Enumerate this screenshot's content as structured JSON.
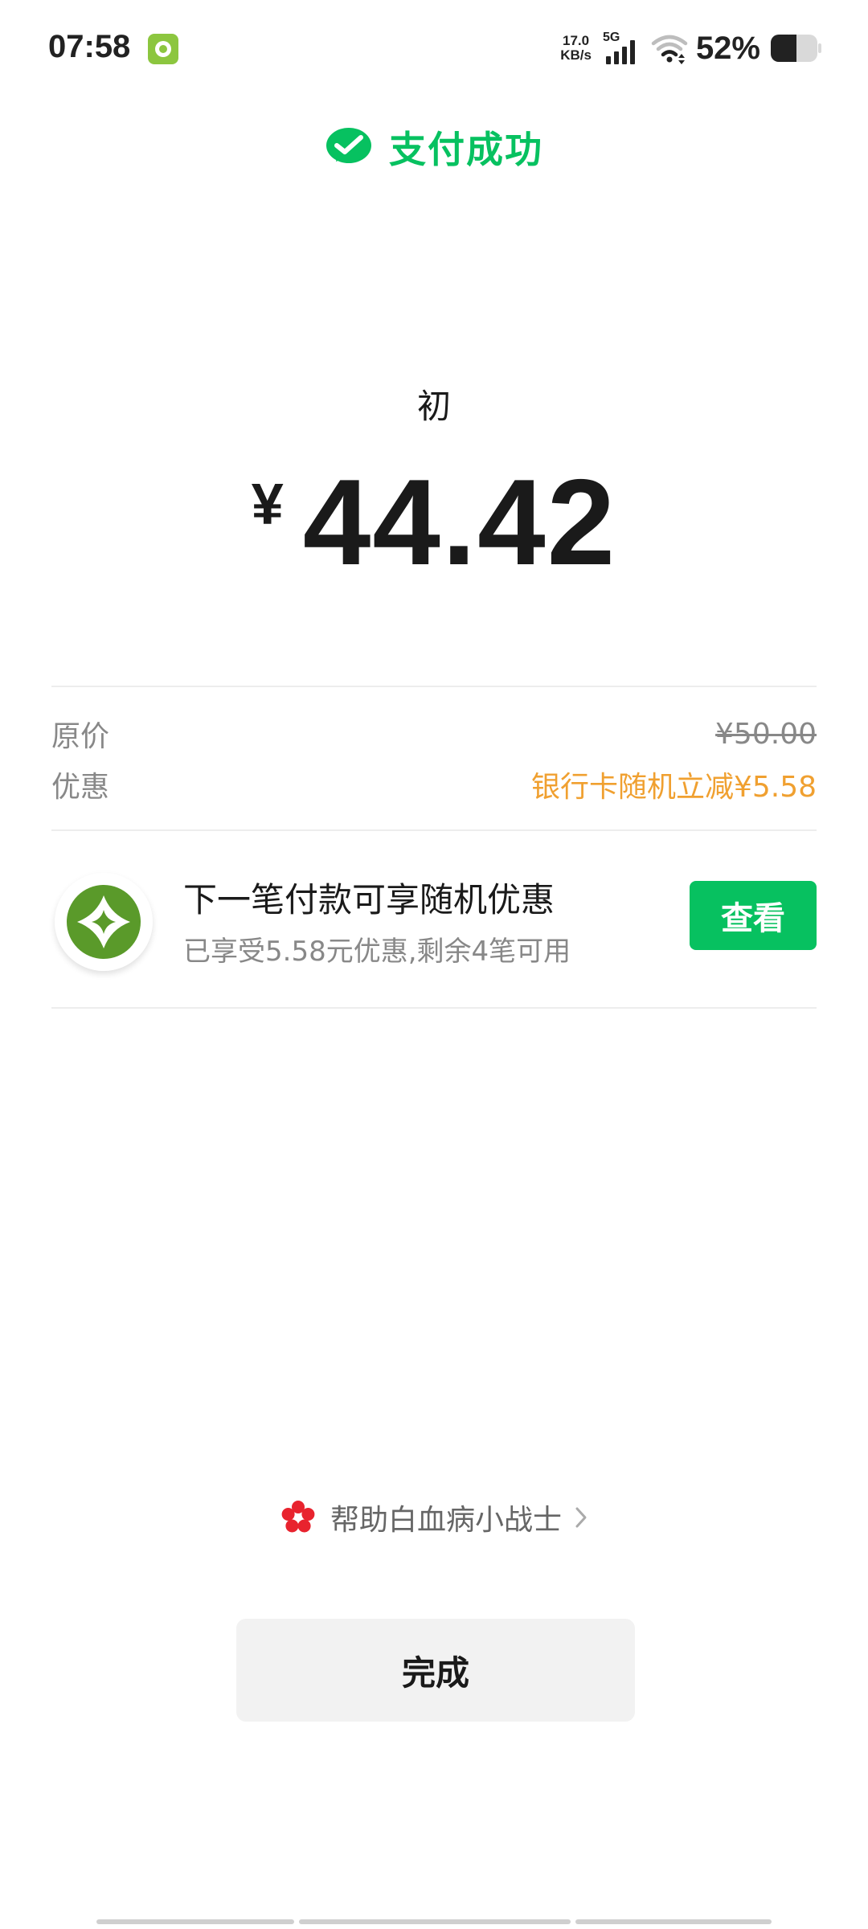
{
  "status_bar": {
    "time": "07:58",
    "net_speed_value": "17.0",
    "net_speed_unit": "KB/s",
    "network_type": "5G",
    "battery_percent": "52%",
    "battery_level": 0.52
  },
  "header": {
    "title": "支付成功"
  },
  "payment": {
    "merchant": "初",
    "currency_symbol": "¥",
    "amount": "44.42"
  },
  "price_details": {
    "original_label": "原价",
    "original_value": "¥50.00",
    "discount_label": "优惠",
    "discount_value": "银行卡随机立减¥5.58"
  },
  "promo": {
    "title": "下一笔付款可享随机优惠",
    "subtitle": "已享受5.58元优惠,剩余4笔可用",
    "button_label": "查看"
  },
  "charity": {
    "text": "帮助白血病小战士"
  },
  "actions": {
    "done_label": "完成"
  },
  "colors": {
    "brand_green": "#07c160",
    "discount_orange": "#f0a030",
    "promo_logo_green": "#5a9a2a"
  }
}
